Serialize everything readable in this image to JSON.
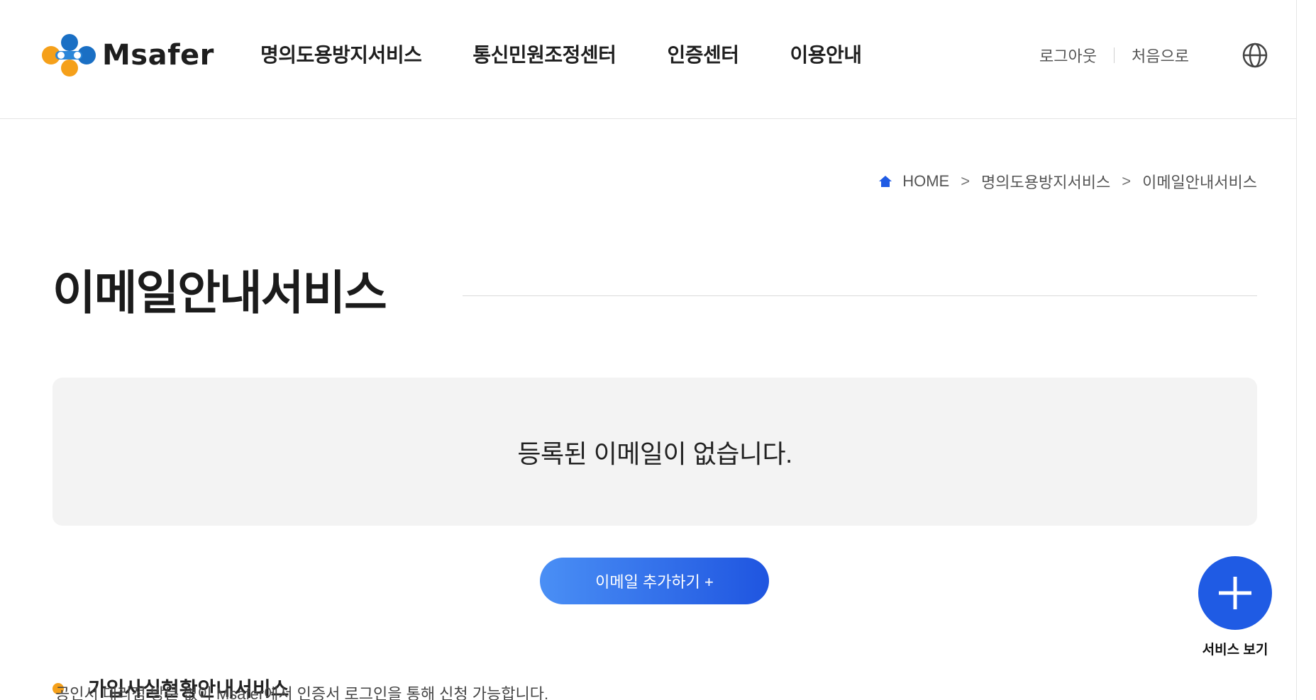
{
  "header": {
    "logo_text": "Msafer",
    "nav": [
      "명의도용방지서비스",
      "통신민원조정센터",
      "인증센터",
      "이용안내"
    ],
    "util": {
      "logout": "로그아웃",
      "home": "처음으로"
    }
  },
  "breadcrumb": {
    "items": [
      "HOME",
      "명의도용방지서비스",
      "이메일안내서비스"
    ],
    "separator": ">"
  },
  "page": {
    "title": "이메일안내서비스",
    "empty_message": "등록된 이메일이 없습니다.",
    "add_button": "이메일 추가하기 +"
  },
  "fab": {
    "label": "서비스 보기"
  },
  "section": {
    "title": "가입사실현황안내서비스",
    "desc": "공인서 대리점 방문 없이 Msafer에서 인증서 로그인을 통해 신청 가능합니다."
  },
  "colors": {
    "accent": "#1f5be4",
    "button_gradient_start": "#4a8ff5",
    "button_gradient_end": "#1f55e0",
    "logo_orange": "#f5a01a",
    "logo_blue": "#1a6fc4",
    "empty_box_bg": "#f3f3f3"
  },
  "icons": {
    "globe": "globe-icon",
    "home": "home-icon",
    "plus": "plus-icon"
  }
}
